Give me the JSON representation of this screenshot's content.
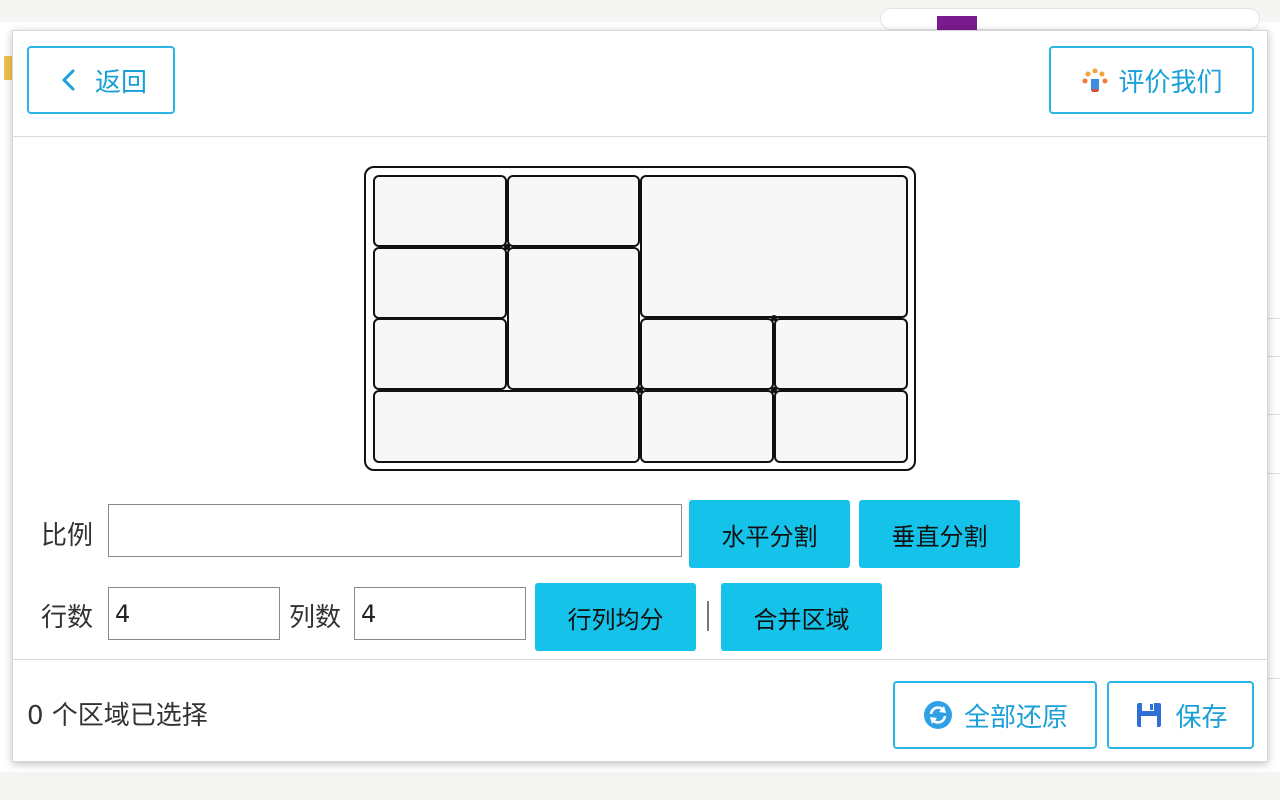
{
  "header": {
    "back_label": "返回",
    "rate_label": "评价我们"
  },
  "form": {
    "ratio_label": "比例",
    "ratio_value": "",
    "split_horizontal_label": "水平分割",
    "split_vertical_label": "垂直分割",
    "rows_label": "行数",
    "rows_value": "4",
    "cols_label": "列数",
    "cols_value": "4",
    "even_split_label": "行列均分",
    "separator": "|",
    "merge_label": "合并区域"
  },
  "footer": {
    "status_text": "0 个区域已选择",
    "restore_label": "全部还原",
    "save_label": "保存"
  },
  "colors": {
    "accent": "#14c2ea",
    "outline": "#29b6e6",
    "link_text": "#1aa0d8"
  },
  "icons": [
    "chevron-left-icon",
    "rating-icon",
    "refresh-icon",
    "floppy-disk-icon"
  ]
}
